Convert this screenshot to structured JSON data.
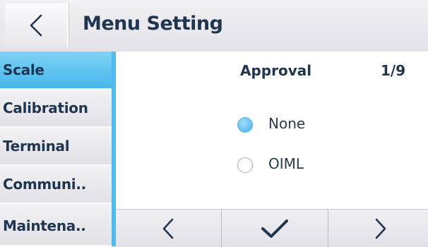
{
  "header": {
    "back_icon": "chevron-left-icon",
    "title": "Menu Setting"
  },
  "sidebar": {
    "items": [
      {
        "label": "Scale",
        "active": true
      },
      {
        "label": "Calibration",
        "active": false
      },
      {
        "label": "Terminal",
        "active": false
      },
      {
        "label": "Communi..",
        "active": false
      },
      {
        "label": "Maintena..",
        "active": false
      }
    ]
  },
  "content": {
    "section_title": "Approval",
    "page_indicator": "1/9",
    "options": [
      {
        "label": "None",
        "selected": true
      },
      {
        "label": "OIML",
        "selected": false
      }
    ]
  },
  "bottom_bar": {
    "prev_icon": "chevron-left-icon",
    "confirm_icon": "checkmark-icon",
    "next_icon": "chevron-right-icon"
  },
  "colors": {
    "accent": "#4fbaf0",
    "text": "#1f3550",
    "header_bg": "#e8e8ec"
  }
}
